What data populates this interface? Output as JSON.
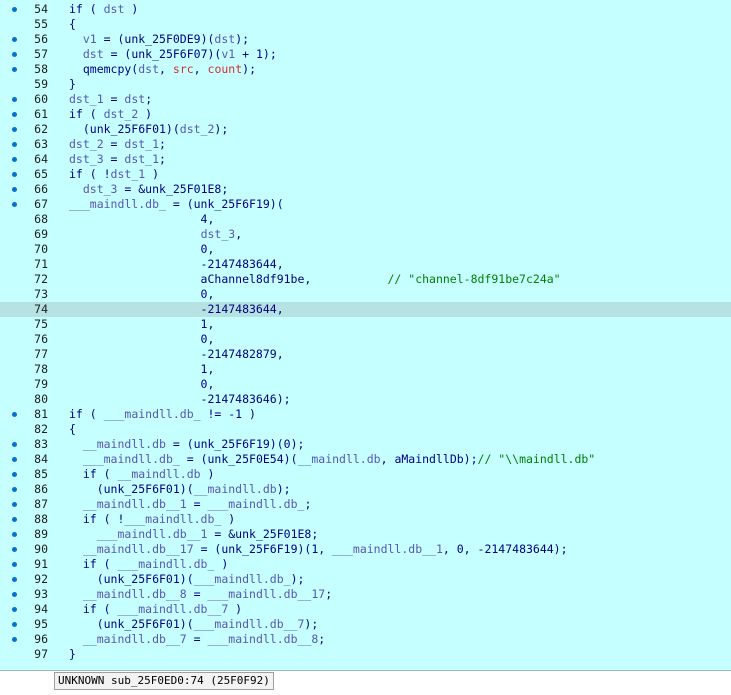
{
  "code_lines": [
    {
      "num": "54",
      "bp": true,
      "tokens": [
        [
          "p",
          "if ( "
        ],
        [
          "v",
          "dst"
        ],
        [
          "p",
          " )"
        ]
      ]
    },
    {
      "num": "55",
      "bp": false,
      "tokens": [
        [
          "p",
          "{"
        ]
      ]
    },
    {
      "num": "56",
      "bp": true,
      "tokens": [
        [
          "p",
          "  "
        ],
        [
          "v",
          "v1"
        ],
        [
          "p",
          " = (unk_25F0DE9)("
        ],
        [
          "v",
          "dst"
        ],
        [
          "p",
          ");"
        ]
      ]
    },
    {
      "num": "57",
      "bp": true,
      "tokens": [
        [
          "p",
          "  "
        ],
        [
          "v",
          "dst"
        ],
        [
          "p",
          " = (unk_25F6F07)("
        ],
        [
          "v",
          "v1"
        ],
        [
          "p",
          " + 1);"
        ]
      ]
    },
    {
      "num": "58",
      "bp": true,
      "tokens": [
        [
          "p",
          "  qmemcpy("
        ],
        [
          "v",
          "dst"
        ],
        [
          "p",
          ", "
        ],
        [
          "r",
          "src"
        ],
        [
          "p",
          ", "
        ],
        [
          "r",
          "count"
        ],
        [
          "p",
          ");"
        ]
      ]
    },
    {
      "num": "59",
      "bp": false,
      "tokens": [
        [
          "p",
          "}"
        ]
      ]
    },
    {
      "num": "60",
      "bp": true,
      "tokens": [
        [
          "v",
          "dst_1"
        ],
        [
          "p",
          " = "
        ],
        [
          "v",
          "dst"
        ],
        [
          "p",
          ";"
        ]
      ]
    },
    {
      "num": "61",
      "bp": true,
      "tokens": [
        [
          "p",
          "if ( "
        ],
        [
          "v",
          "dst_2"
        ],
        [
          "p",
          " )"
        ]
      ]
    },
    {
      "num": "62",
      "bp": true,
      "tokens": [
        [
          "p",
          "  (unk_25F6F01)("
        ],
        [
          "v",
          "dst_2"
        ],
        [
          "p",
          ");"
        ]
      ]
    },
    {
      "num": "63",
      "bp": true,
      "tokens": [
        [
          "v",
          "dst_2"
        ],
        [
          "p",
          " = "
        ],
        [
          "v",
          "dst_1"
        ],
        [
          "p",
          ";"
        ]
      ]
    },
    {
      "num": "64",
      "bp": true,
      "tokens": [
        [
          "v",
          "dst_3"
        ],
        [
          "p",
          " = "
        ],
        [
          "v",
          "dst_1"
        ],
        [
          "p",
          ";"
        ]
      ]
    },
    {
      "num": "65",
      "bp": true,
      "tokens": [
        [
          "p",
          "if ( !"
        ],
        [
          "v",
          "dst_1"
        ],
        [
          "p",
          " )"
        ]
      ]
    },
    {
      "num": "66",
      "bp": true,
      "tokens": [
        [
          "p",
          "  "
        ],
        [
          "v",
          "dst_3"
        ],
        [
          "p",
          " = &unk_25F01E8;"
        ]
      ]
    },
    {
      "num": "67",
      "bp": true,
      "tokens": [
        [
          "v",
          "___maindll.db_"
        ],
        [
          "p",
          " = (unk_25F6F19)("
        ]
      ]
    },
    {
      "num": "68",
      "bp": false,
      "tokens": [
        [
          "p",
          "                   4,"
        ]
      ]
    },
    {
      "num": "69",
      "bp": false,
      "tokens": [
        [
          "p",
          "                   "
        ],
        [
          "v",
          "dst_3"
        ],
        [
          "p",
          ","
        ]
      ]
    },
    {
      "num": "70",
      "bp": false,
      "tokens": [
        [
          "p",
          "                   0,"
        ]
      ]
    },
    {
      "num": "71",
      "bp": false,
      "tokens": [
        [
          "p",
          "                   -2147483644,"
        ]
      ]
    },
    {
      "num": "72",
      "bp": false,
      "tokens": [
        [
          "p",
          "                   aChannel8df91be,           "
        ],
        [
          "c",
          "// \"channel-8df91be7c24a\""
        ]
      ]
    },
    {
      "num": "73",
      "bp": false,
      "tokens": [
        [
          "p",
          "                   0,"
        ]
      ]
    },
    {
      "num": "74",
      "bp": false,
      "hl": true,
      "tokens": [
        [
          "p",
          "                   -2147483644,"
        ]
      ]
    },
    {
      "num": "75",
      "bp": false,
      "tokens": [
        [
          "p",
          "                   1,"
        ]
      ]
    },
    {
      "num": "76",
      "bp": false,
      "tokens": [
        [
          "p",
          "                   0,"
        ]
      ]
    },
    {
      "num": "77",
      "bp": false,
      "tokens": [
        [
          "p",
          "                   -2147482879,"
        ]
      ]
    },
    {
      "num": "78",
      "bp": false,
      "tokens": [
        [
          "p",
          "                   1,"
        ]
      ]
    },
    {
      "num": "79",
      "bp": false,
      "tokens": [
        [
          "p",
          "                   0,"
        ]
      ]
    },
    {
      "num": "80",
      "bp": false,
      "tokens": [
        [
          "p",
          "                   -2147483646);"
        ]
      ]
    },
    {
      "num": "81",
      "bp": true,
      "tokens": [
        [
          "p",
          "if ( "
        ],
        [
          "v",
          "___maindll.db_"
        ],
        [
          "p",
          " != -1 )"
        ]
      ]
    },
    {
      "num": "82",
      "bp": false,
      "tokens": [
        [
          "p",
          "{"
        ]
      ]
    },
    {
      "num": "83",
      "bp": true,
      "tokens": [
        [
          "p",
          "  "
        ],
        [
          "v",
          "__maindll.db"
        ],
        [
          "p",
          " = (unk_25F6F19)(0);"
        ]
      ]
    },
    {
      "num": "84",
      "bp": true,
      "tokens": [
        [
          "p",
          "  "
        ],
        [
          "v",
          "___maindll.db_"
        ],
        [
          "p",
          " = (unk_25F0E54)("
        ],
        [
          "v",
          "__maindll.db"
        ],
        [
          "p",
          ", aMaindllDb);"
        ],
        [
          "c",
          "// \"\\\\maindll.db\""
        ]
      ]
    },
    {
      "num": "85",
      "bp": true,
      "tokens": [
        [
          "p",
          "  if ( "
        ],
        [
          "v",
          "__maindll.db"
        ],
        [
          "p",
          " )"
        ]
      ]
    },
    {
      "num": "86",
      "bp": true,
      "tokens": [
        [
          "p",
          "    (unk_25F6F01)("
        ],
        [
          "v",
          "__maindll.db"
        ],
        [
          "p",
          ");"
        ]
      ]
    },
    {
      "num": "87",
      "bp": true,
      "tokens": [
        [
          "p",
          "  "
        ],
        [
          "v",
          "__maindll.db__1"
        ],
        [
          "p",
          " = "
        ],
        [
          "v",
          "___maindll.db_"
        ],
        [
          "p",
          ";"
        ]
      ]
    },
    {
      "num": "88",
      "bp": true,
      "tokens": [
        [
          "p",
          "  if ( !"
        ],
        [
          "v",
          "___maindll.db_"
        ],
        [
          "p",
          " )"
        ]
      ]
    },
    {
      "num": "89",
      "bp": true,
      "tokens": [
        [
          "p",
          "    "
        ],
        [
          "v",
          "___maindll.db__1"
        ],
        [
          "p",
          " = &unk_25F01E8;"
        ]
      ]
    },
    {
      "num": "90",
      "bp": true,
      "tokens": [
        [
          "p",
          "  "
        ],
        [
          "v",
          "__maindll.db__17"
        ],
        [
          "p",
          " = (unk_25F6F19)(1, "
        ],
        [
          "v",
          "___maindll.db__1"
        ],
        [
          "p",
          ", 0, -2147483644);"
        ]
      ]
    },
    {
      "num": "91",
      "bp": true,
      "tokens": [
        [
          "p",
          "  if ( "
        ],
        [
          "v",
          "___maindll.db_"
        ],
        [
          "p",
          " )"
        ]
      ]
    },
    {
      "num": "92",
      "bp": true,
      "tokens": [
        [
          "p",
          "    (unk_25F6F01)("
        ],
        [
          "v",
          "___maindll.db_"
        ],
        [
          "p",
          ");"
        ]
      ]
    },
    {
      "num": "93",
      "bp": true,
      "tokens": [
        [
          "p",
          "  "
        ],
        [
          "v",
          "__maindll.db__8"
        ],
        [
          "p",
          " = "
        ],
        [
          "v",
          "___maindll.db__17"
        ],
        [
          "p",
          ";"
        ]
      ]
    },
    {
      "num": "94",
      "bp": true,
      "tokens": [
        [
          "p",
          "  if ( "
        ],
        [
          "v",
          "___maindll.db__7"
        ],
        [
          "p",
          " )"
        ]
      ]
    },
    {
      "num": "95",
      "bp": true,
      "tokens": [
        [
          "p",
          "    (unk_25F6F01)("
        ],
        [
          "v",
          "___maindll.db__7"
        ],
        [
          "p",
          ");"
        ]
      ]
    },
    {
      "num": "96",
      "bp": true,
      "tokens": [
        [
          "p",
          "  "
        ],
        [
          "v",
          "__maindll.db__7"
        ],
        [
          "p",
          " = "
        ],
        [
          "v",
          "___maindll.db__8"
        ],
        [
          "p",
          ";"
        ]
      ]
    },
    {
      "num": "97",
      "bp": false,
      "tokens": [
        [
          "p",
          "}"
        ]
      ]
    }
  ],
  "status_bar": {
    "text": "UNKNOWN sub_25F0ED0:74 (25F0F92)"
  },
  "colors": {
    "background": "#c6ffff",
    "current_line": "#b6e2e2",
    "plain": "#000080",
    "variable": "#5858b0",
    "argument": "#d03030",
    "comment": "#008000",
    "breakpoint_dot": "#0a70d0"
  }
}
